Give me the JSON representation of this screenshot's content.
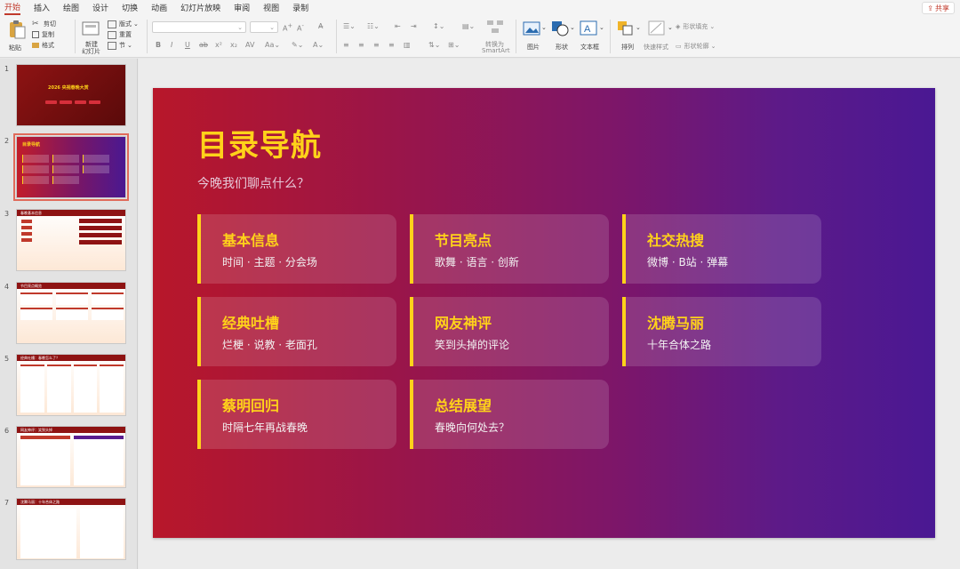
{
  "menu": {
    "tabs": [
      "开始",
      "插入",
      "绘图",
      "设计",
      "切换",
      "动画",
      "幻灯片放映",
      "审阅",
      "视图",
      "录制"
    ],
    "active": "开始",
    "share": "共享"
  },
  "ribbon": {
    "paste": "粘贴",
    "cut": "剪切",
    "copy": "复制",
    "format": "格式",
    "new_slide_1": "新建",
    "new_slide_2": "幻灯片",
    "layout": "版式",
    "reset": "重置",
    "section": "节",
    "smartart_1": "转换为",
    "smartart_2": "SmartArt",
    "picture": "图片",
    "shape": "形状",
    "textbox": "文本框",
    "arrange": "排列",
    "quick_styles": "快速样式",
    "shape_fill": "形状填充",
    "shape_outline": "形状轮廓"
  },
  "thumbnails": [
    {
      "num": "1",
      "title": "2026 央视春晚大赏"
    },
    {
      "num": "2",
      "title": "目录导航"
    },
    {
      "num": "3",
      "title": "春晚基本信息"
    },
    {
      "num": "4",
      "title": "节目亮点概览"
    },
    {
      "num": "5",
      "title": "经典吐槽：春晚怎么了？"
    },
    {
      "num": "6",
      "title": "网友神评：笑到头掉"
    },
    {
      "num": "7",
      "title": "沈腾马丽：十年合体之路"
    }
  ],
  "slide": {
    "title": "目录导航",
    "subtitle": "今晚我们聊点什么？",
    "accent_color": "#ffd21a",
    "cards": [
      {
        "title": "基本信息",
        "sub": "时间 · 主题 · 分会场"
      },
      {
        "title": "节目亮点",
        "sub": "歌舞 · 语言 · 创新"
      },
      {
        "title": "社交热搜",
        "sub": "微博 · B站 · 弹幕"
      },
      {
        "title": "经典吐槽",
        "sub": "烂梗 · 说教 · 老面孔"
      },
      {
        "title": "网友神评",
        "sub": "笑到头掉的评论"
      },
      {
        "title": "沈腾马丽",
        "sub": "十年合体之路"
      },
      {
        "title": "蔡明回归",
        "sub": "时隔七年再战春晚"
      },
      {
        "title": "总结展望",
        "sub": "春晚向何处去？"
      }
    ]
  }
}
